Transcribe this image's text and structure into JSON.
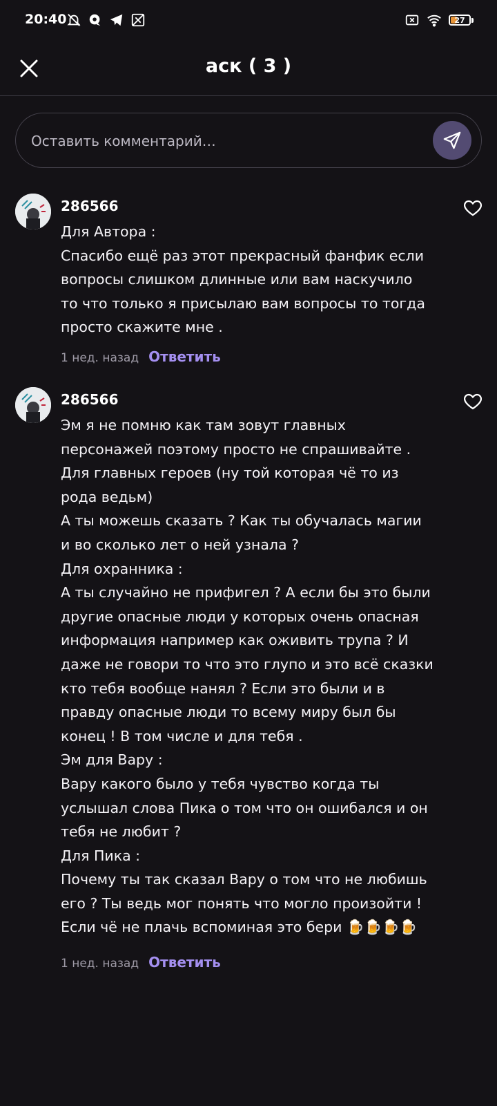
{
  "status_bar": {
    "time": "20:40",
    "battery_level": "27",
    "battery_color": "#e8953a",
    "left_icons": [
      "muted-bell-icon",
      "chat-bubble-icon",
      "telegram-icon",
      "app-icon"
    ],
    "right_icons": [
      "sim-off-icon",
      "wifi-icon",
      "battery-icon"
    ]
  },
  "header": {
    "title": "аск ( 3 )",
    "close_icon": "close-icon"
  },
  "comment_input": {
    "placeholder": "Оставить комментарий…",
    "send_icon": "send-icon"
  },
  "colors": {
    "background": "#141216",
    "accent": "#a48ff0",
    "send_button": "#534b72"
  },
  "comments": [
    {
      "username": "286566",
      "text": "Для Автора :\nСпасибо ещё раз этот прекрасный фанфик если вопросы слишком длинные или вам наскучило то что только я присылаю вам вопросы то тогда просто скажите мне .",
      "time": "1 нед. назад",
      "reply_label": "Ответить"
    },
    {
      "username": "286566",
      "text": "Эм я не помню как там зовут главных персонажей поэтому просто не спрашивайте .\nДля главных героев (ну той которая чё то из рода ведьм)\nА ты можешь сказать ? Как ты обучалась магии и во сколько лет о ней узнала ?\nДля охранника :\nА ты случайно не прифигел ? А если бы это были другие опасные люди у которых очень опасная информация например как оживить трупа ? И даже не говори то что это глупо и это всё сказки кто тебя вообще нанял ? Если это были и в правду опасные люди то всему миру был бы конец ! В том числе и для тебя .\nЭм для Вару :\nВару какого было у тебя чувство когда ты услышал слова Пика о том что он ошибался и он тебя не любит ?\nДля Пика :\nПочему ты так сказал Вару о том что не любишь его ? Ты ведь мог понять что могло произойти ! Если чё не плачь вспоминая это бери 🍺🍺🍺🍺",
      "time": "1 нед. назад",
      "reply_label": "Ответить"
    }
  ]
}
